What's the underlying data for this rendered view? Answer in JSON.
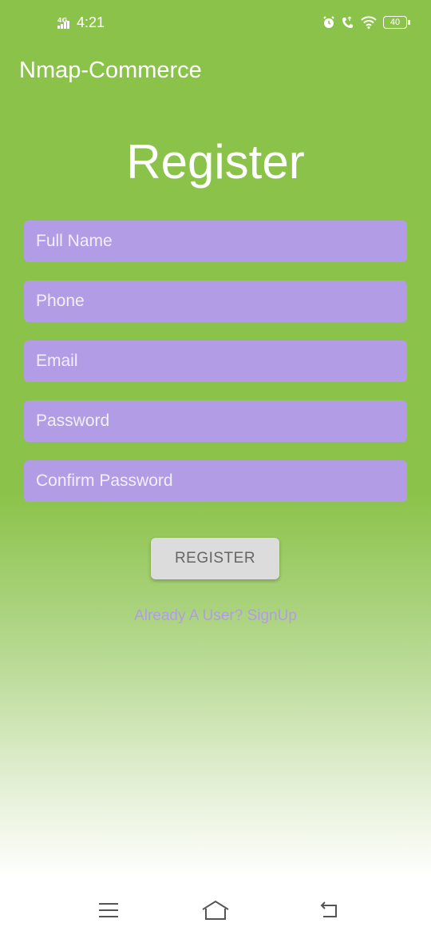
{
  "status_bar": {
    "network": "4G",
    "time": "4:21",
    "battery": "40",
    "icons": [
      "signal-icon",
      "alarm-icon",
      "call-icon",
      "wifi-icon",
      "battery-icon"
    ]
  },
  "app": {
    "title": "Nmap-Commerce"
  },
  "form": {
    "title": "Register",
    "fields": [
      {
        "placeholder": "Full Name",
        "value": ""
      },
      {
        "placeholder": "Phone",
        "value": ""
      },
      {
        "placeholder": "Email",
        "value": ""
      },
      {
        "placeholder": "Password",
        "value": ""
      },
      {
        "placeholder": "Confirm Password",
        "value": ""
      }
    ],
    "submit_label": "REGISTER",
    "signup_link": "Already A User? SignUp"
  },
  "nav": {
    "icons": [
      "menu-icon",
      "home-icon",
      "back-icon"
    ]
  },
  "colors": {
    "background": "#8bc34a",
    "field": "#b39ce6",
    "button": "#dcdcdc",
    "link": "#b39ce6"
  }
}
